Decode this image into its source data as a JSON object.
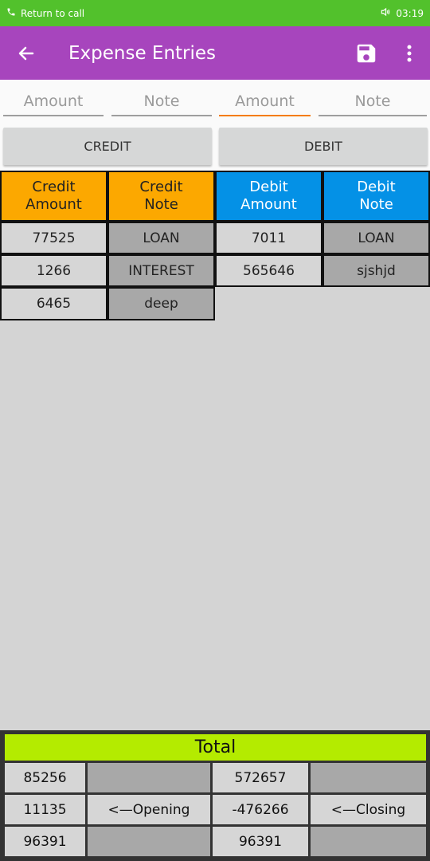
{
  "status_bar": {
    "left_text": "Return to call",
    "time": "03:19",
    "bg_color": "#52c12c"
  },
  "app_bar": {
    "title": "Expense Entries",
    "bg_color": "#a745bd",
    "icons": [
      "back-arrow-icon",
      "save-icon",
      "more-vert-icon"
    ]
  },
  "inputs": {
    "credit_amount_placeholder": "Amount",
    "credit_note_placeholder": "Note",
    "debit_amount_placeholder": "Amount",
    "debit_note_placeholder": "Note"
  },
  "buttons": {
    "credit_label": "CREDIT",
    "debit_label": "DEBIT"
  },
  "table": {
    "headers": {
      "credit_amount": "Credit\nAmount",
      "credit_note": "Credit\nNote",
      "debit_amount": "Debit\nAmount",
      "debit_note": "Debit\nNote"
    },
    "header_colors": {
      "credit": "#fca800",
      "debit": "#0491e6"
    },
    "credit_rows": [
      {
        "amount": "77525",
        "note": "LOAN"
      },
      {
        "amount": "1266",
        "note": "INTEREST"
      },
      {
        "amount": "6465",
        "note": "deep"
      }
    ],
    "debit_rows": [
      {
        "amount": "7011",
        "note": "LOAN"
      },
      {
        "amount": "565646",
        "note": "sjshjd"
      }
    ]
  },
  "totals": {
    "title": "Total",
    "title_color": "#b4eb00",
    "credit_total": "85256",
    "debit_total": "572657",
    "opening_value": "11135",
    "opening_label": "<—Opening",
    "closing_value": "-476266",
    "closing_label": "<—Closing",
    "credit_final": "96391",
    "debit_final": "96391"
  }
}
